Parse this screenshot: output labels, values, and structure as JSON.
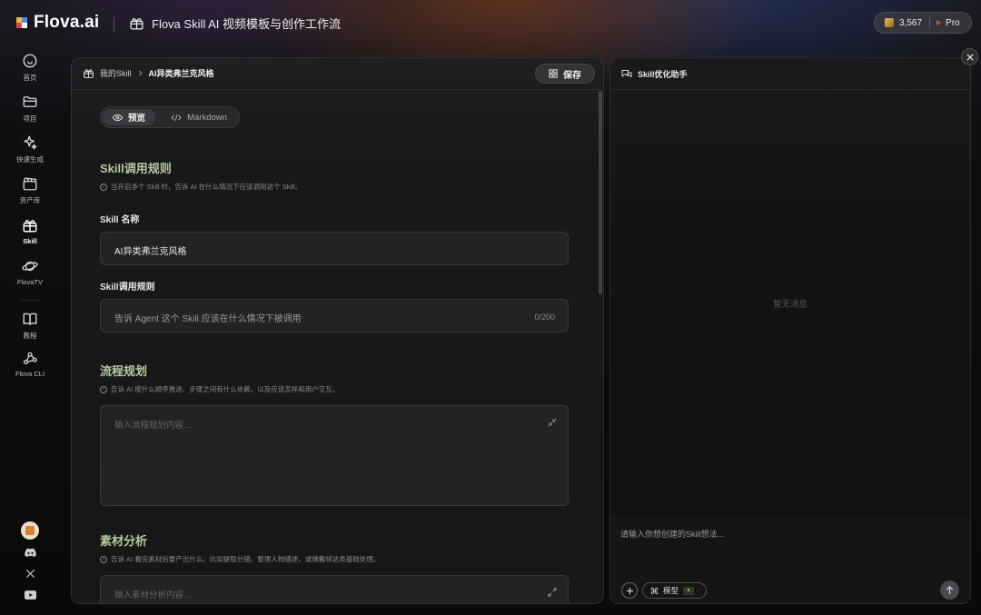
{
  "brand": {
    "name": "Flova.ai"
  },
  "header": {
    "title": "Flova Skill AI 视频模板与创作工作流",
    "credits": "3,567",
    "plan": "Pro"
  },
  "sidebar": {
    "items": [
      {
        "label": "首页",
        "icon": "home-icon"
      },
      {
        "label": "项目",
        "icon": "folder-icon"
      },
      {
        "label": "快速生成",
        "icon": "sparkle-icon"
      },
      {
        "label": "资产库",
        "icon": "clapperboard-icon"
      },
      {
        "label": "Skill",
        "icon": "gift-box-icon",
        "active": true
      },
      {
        "label": "FlovaTV",
        "icon": "planet-icon"
      },
      {
        "label": "教程",
        "icon": "book-icon"
      },
      {
        "label": "Flova CLI",
        "icon": "node-graph-icon"
      }
    ]
  },
  "editor": {
    "breadcrumb_root": "我的Skill",
    "breadcrumb_current": "AI异类弗兰克风格",
    "save_label": "保存",
    "view_preview": "预览",
    "view_markdown": "Markdown",
    "section1": {
      "title": "Skill调用规则",
      "hint": "当开启多个 Skill 时，告诉 AI 在什么情况下应该调用这个 Skill。",
      "name_label": "Skill 名称",
      "name_value": "AI异类弗兰克风格",
      "rule_label": "Skill调用规则",
      "rule_placeholder": "告诉 Agent 这个 Skill 应该在什么情况下被调用",
      "rule_count": "0/200"
    },
    "section2": {
      "title": "流程规划",
      "hint": "告诉 AI 按什么顺序推进、步骤之间有什么依赖，以及应该怎样和用户交互。",
      "placeholder": "输入流程规划内容..."
    },
    "section3": {
      "title": "素材分析",
      "hint": "告诉 AI 看完素材后要产出什么。比如提取分镜、整理人物描述，或做戴帧这类基础处理。",
      "placeholder": "输入素材分析内容..."
    }
  },
  "chat": {
    "title": "Skill优化助手",
    "empty": "暂无消息",
    "input_placeholder": "请输入你想创建的Skill想法...",
    "model_label": "模型"
  },
  "colors": {
    "accent_green": "#b7c8a0",
    "background": "#0f0f12",
    "panel": "#1a1a1c"
  }
}
